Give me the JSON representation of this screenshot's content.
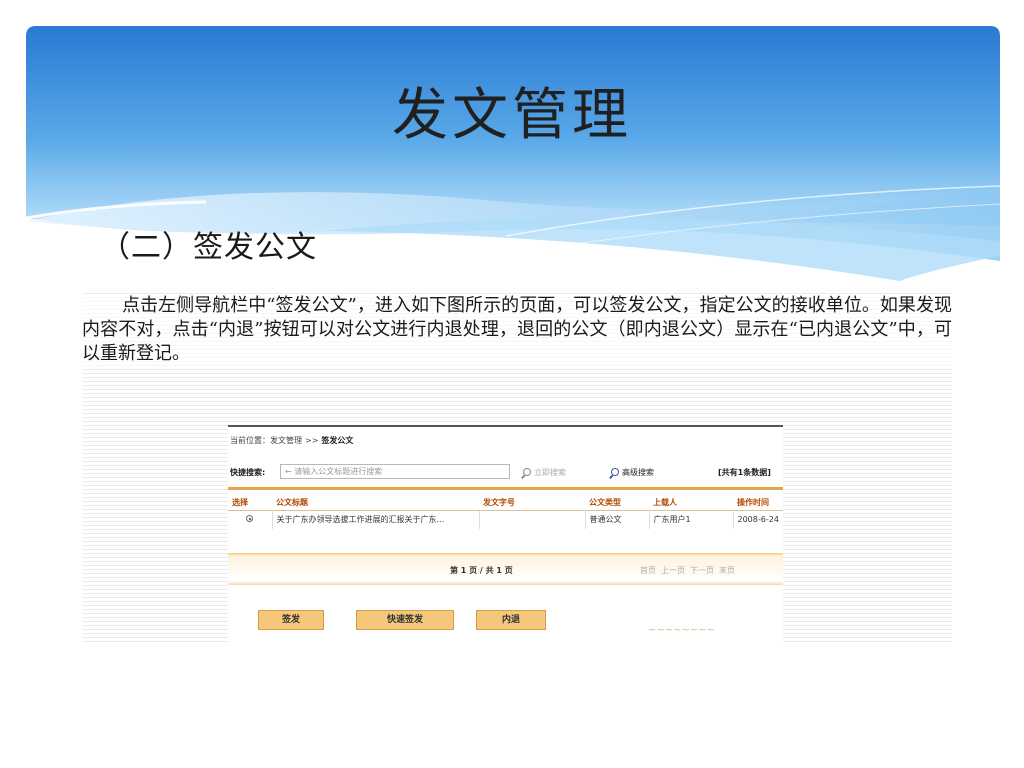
{
  "slide": {
    "title": "发文管理",
    "subtitle": "（二）签发公文"
  },
  "document": {
    "paragraph": "点击左侧导航栏中“签发公文”，进入如下图所示的页面，可以签发公文，指定公文的接收单位。如果发现内容不对，点击“内退”按钮可以对公文进行内退处理，退回的公文（即内退公文）显示在“已内退公文”中，可以重新登记。"
  },
  "app": {
    "breadcrumb": {
      "label": "当前位置：",
      "parent": "发文管理",
      "separator": ">>",
      "current": "签发公文"
    },
    "search": {
      "label": "快捷搜索:",
      "placeholder": "← 请输入公文标题进行搜索",
      "immediate_label": "立即搜索",
      "advanced_label": "高级搜索",
      "total": "[共有1条数据]"
    },
    "table": {
      "headers": [
        "选择",
        "公文标题",
        "发文字号",
        "公文类型",
        "上载人",
        "操作时间"
      ],
      "rows": [
        {
          "title": "关于广东办领导选拔工作进展的汇报关于广东...",
          "doc_number": "",
          "type": "普通公文",
          "uploader": "广东用户1",
          "time": "2008-6-24"
        }
      ]
    },
    "pager": {
      "summary": "第 1 页 / 共 1 页",
      "first": "首页",
      "prev": "上一页",
      "next": "下一页",
      "last": "末页"
    },
    "buttons": {
      "sign": "签发",
      "fast_sign": "快速签发",
      "return": "内退"
    }
  },
  "colors": {
    "banner_top": "#2f7fd6",
    "banner_light": "#9fd0f5",
    "button_fill": "#f5c77a",
    "header_text": "#b34a00"
  }
}
